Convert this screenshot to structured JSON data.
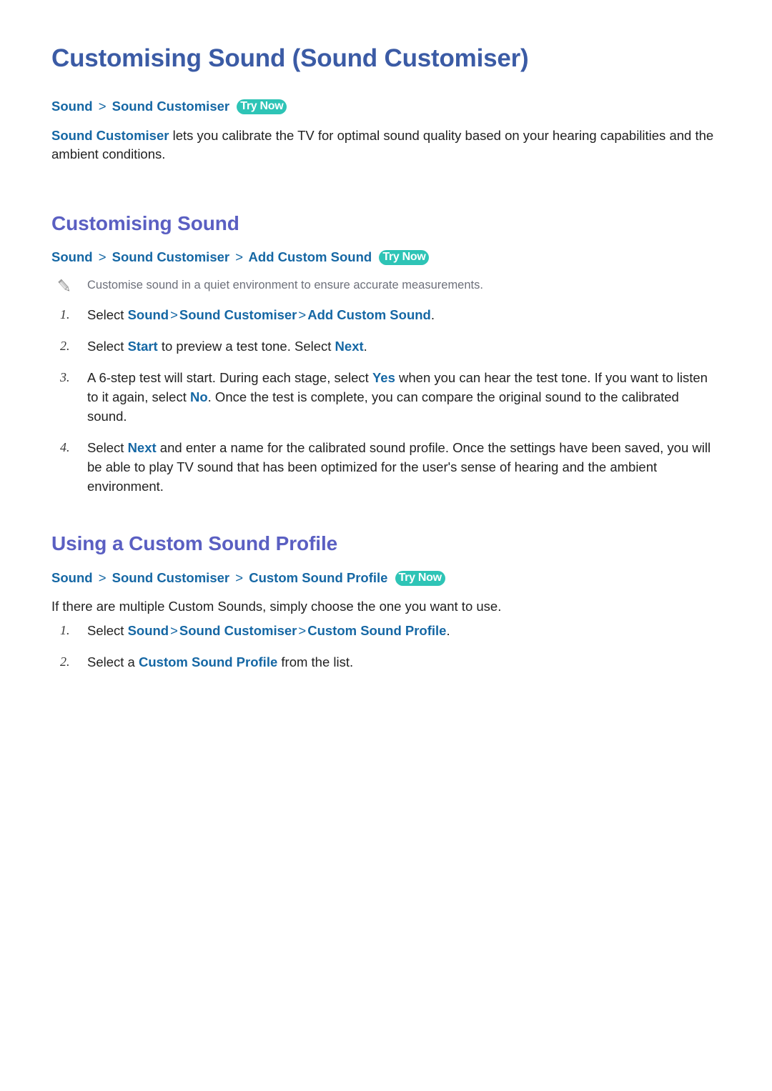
{
  "document": {
    "title": "Customising Sound (Sound Customiser)",
    "top_breadcrumb": {
      "items": [
        "Sound",
        "Sound Customiser"
      ],
      "separator": ">",
      "badge": "Try Now"
    },
    "intro": {
      "lead_bold": "Sound Customiser",
      "text": " lets you calibrate the TV for optimal sound quality based on your hearing capabilities and the ambient conditions."
    }
  },
  "sections": [
    {
      "heading": "Customising Sound",
      "breadcrumb": {
        "items": [
          "Sound",
          "Sound Customiser",
          "Add Custom Sound"
        ],
        "separator": ">",
        "badge": "Try Now"
      },
      "note": {
        "icon": "pencil-icon",
        "text": "Customise sound in a quiet environment to ensure accurate measurements."
      },
      "steps": [
        {
          "prefix": "Select ",
          "path": [
            "Sound",
            "Sound Customiser",
            "Add Custom Sound"
          ],
          "suffix": "."
        },
        {
          "p1": "Select ",
          "k1": "Start",
          "p2": " to preview a test tone. Select ",
          "k2": "Next",
          "p3": "."
        },
        {
          "p1": "A 6-step test will start. During each stage, select ",
          "k1": "Yes",
          "p2": " when you can hear the test tone. If you want to listen to it again, select ",
          "k2": "No",
          "p3": ". Once the test is complete, you can compare the original sound to the calibrated sound."
        },
        {
          "p1": "Select ",
          "k1": "Next",
          "p2": " and enter a name for the calibrated sound profile. Once the settings have been saved, you will be able to play TV sound that has been optimized for the user's sense of hearing and the ambient environment."
        }
      ]
    },
    {
      "heading": "Using a Custom Sound Profile",
      "breadcrumb": {
        "items": [
          "Sound",
          "Sound Customiser",
          "Custom Sound Profile"
        ],
        "separator": ">",
        "badge": "Try Now"
      },
      "paragraph": "If there are multiple Custom Sounds, simply choose the one you want to use.",
      "steps": [
        {
          "prefix": "Select ",
          "path": [
            "Sound",
            "Sound Customiser",
            "Custom Sound Profile"
          ],
          "suffix": "."
        },
        {
          "p1": "Select a ",
          "k1": "Custom Sound Profile",
          "p2": " from the list."
        }
      ]
    }
  ],
  "colors": {
    "doc_title": "#3b5ba5",
    "section_heading": "#5a5fc2",
    "link_blue": "#1567a4",
    "badge_teal": "#2ec4b6",
    "body_text": "#222222",
    "note_text": "#6d707a"
  }
}
